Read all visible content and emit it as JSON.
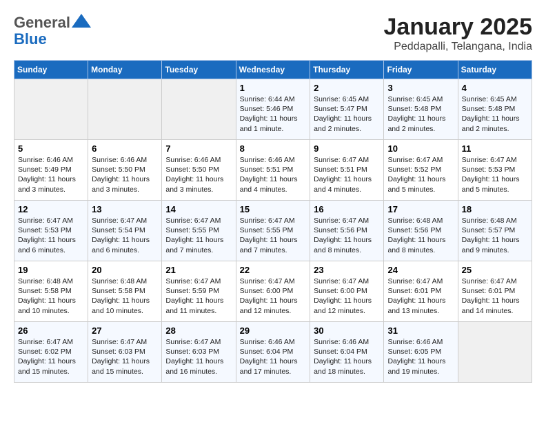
{
  "header": {
    "logo_line1": "General",
    "logo_line2": "Blue",
    "month": "January 2025",
    "location": "Peddapalli, Telangana, India"
  },
  "weekdays": [
    "Sunday",
    "Monday",
    "Tuesday",
    "Wednesday",
    "Thursday",
    "Friday",
    "Saturday"
  ],
  "weeks": [
    [
      {
        "day": "",
        "info": ""
      },
      {
        "day": "",
        "info": ""
      },
      {
        "day": "",
        "info": ""
      },
      {
        "day": "1",
        "info": "Sunrise: 6:44 AM\nSunset: 5:46 PM\nDaylight: 11 hours\nand 1 minute."
      },
      {
        "day": "2",
        "info": "Sunrise: 6:45 AM\nSunset: 5:47 PM\nDaylight: 11 hours\nand 2 minutes."
      },
      {
        "day": "3",
        "info": "Sunrise: 6:45 AM\nSunset: 5:48 PM\nDaylight: 11 hours\nand 2 minutes."
      },
      {
        "day": "4",
        "info": "Sunrise: 6:45 AM\nSunset: 5:48 PM\nDaylight: 11 hours\nand 2 minutes."
      }
    ],
    [
      {
        "day": "5",
        "info": "Sunrise: 6:46 AM\nSunset: 5:49 PM\nDaylight: 11 hours\nand 3 minutes."
      },
      {
        "day": "6",
        "info": "Sunrise: 6:46 AM\nSunset: 5:50 PM\nDaylight: 11 hours\nand 3 minutes."
      },
      {
        "day": "7",
        "info": "Sunrise: 6:46 AM\nSunset: 5:50 PM\nDaylight: 11 hours\nand 3 minutes."
      },
      {
        "day": "8",
        "info": "Sunrise: 6:46 AM\nSunset: 5:51 PM\nDaylight: 11 hours\nand 4 minutes."
      },
      {
        "day": "9",
        "info": "Sunrise: 6:47 AM\nSunset: 5:51 PM\nDaylight: 11 hours\nand 4 minutes."
      },
      {
        "day": "10",
        "info": "Sunrise: 6:47 AM\nSunset: 5:52 PM\nDaylight: 11 hours\nand 5 minutes."
      },
      {
        "day": "11",
        "info": "Sunrise: 6:47 AM\nSunset: 5:53 PM\nDaylight: 11 hours\nand 5 minutes."
      }
    ],
    [
      {
        "day": "12",
        "info": "Sunrise: 6:47 AM\nSunset: 5:53 PM\nDaylight: 11 hours\nand 6 minutes."
      },
      {
        "day": "13",
        "info": "Sunrise: 6:47 AM\nSunset: 5:54 PM\nDaylight: 11 hours\nand 6 minutes."
      },
      {
        "day": "14",
        "info": "Sunrise: 6:47 AM\nSunset: 5:55 PM\nDaylight: 11 hours\nand 7 minutes."
      },
      {
        "day": "15",
        "info": "Sunrise: 6:47 AM\nSunset: 5:55 PM\nDaylight: 11 hours\nand 7 minutes."
      },
      {
        "day": "16",
        "info": "Sunrise: 6:47 AM\nSunset: 5:56 PM\nDaylight: 11 hours\nand 8 minutes."
      },
      {
        "day": "17",
        "info": "Sunrise: 6:48 AM\nSunset: 5:56 PM\nDaylight: 11 hours\nand 8 minutes."
      },
      {
        "day": "18",
        "info": "Sunrise: 6:48 AM\nSunset: 5:57 PM\nDaylight: 11 hours\nand 9 minutes."
      }
    ],
    [
      {
        "day": "19",
        "info": "Sunrise: 6:48 AM\nSunset: 5:58 PM\nDaylight: 11 hours\nand 10 minutes."
      },
      {
        "day": "20",
        "info": "Sunrise: 6:48 AM\nSunset: 5:58 PM\nDaylight: 11 hours\nand 10 minutes."
      },
      {
        "day": "21",
        "info": "Sunrise: 6:47 AM\nSunset: 5:59 PM\nDaylight: 11 hours\nand 11 minutes."
      },
      {
        "day": "22",
        "info": "Sunrise: 6:47 AM\nSunset: 6:00 PM\nDaylight: 11 hours\nand 12 minutes."
      },
      {
        "day": "23",
        "info": "Sunrise: 6:47 AM\nSunset: 6:00 PM\nDaylight: 11 hours\nand 12 minutes."
      },
      {
        "day": "24",
        "info": "Sunrise: 6:47 AM\nSunset: 6:01 PM\nDaylight: 11 hours\nand 13 minutes."
      },
      {
        "day": "25",
        "info": "Sunrise: 6:47 AM\nSunset: 6:01 PM\nDaylight: 11 hours\nand 14 minutes."
      }
    ],
    [
      {
        "day": "26",
        "info": "Sunrise: 6:47 AM\nSunset: 6:02 PM\nDaylight: 11 hours\nand 15 minutes."
      },
      {
        "day": "27",
        "info": "Sunrise: 6:47 AM\nSunset: 6:03 PM\nDaylight: 11 hours\nand 15 minutes."
      },
      {
        "day": "28",
        "info": "Sunrise: 6:47 AM\nSunset: 6:03 PM\nDaylight: 11 hours\nand 16 minutes."
      },
      {
        "day": "29",
        "info": "Sunrise: 6:46 AM\nSunset: 6:04 PM\nDaylight: 11 hours\nand 17 minutes."
      },
      {
        "day": "30",
        "info": "Sunrise: 6:46 AM\nSunset: 6:04 PM\nDaylight: 11 hours\nand 18 minutes."
      },
      {
        "day": "31",
        "info": "Sunrise: 6:46 AM\nSunset: 6:05 PM\nDaylight: 11 hours\nand 19 minutes."
      },
      {
        "day": "",
        "info": ""
      }
    ]
  ]
}
